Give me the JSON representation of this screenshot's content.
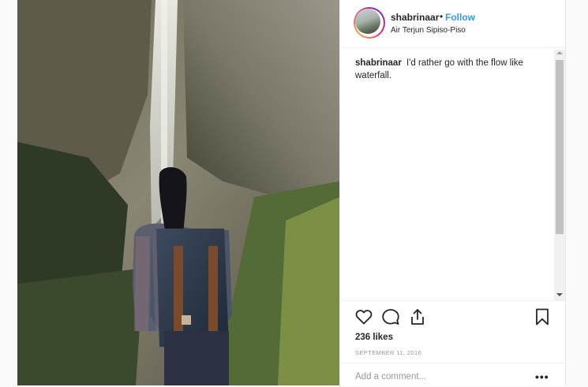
{
  "post": {
    "username": "shabrinaar",
    "separator": "•",
    "follow_label": "Follow",
    "location": "Air Terjun Sipiso-Piso",
    "caption_user": "shabrinaar",
    "caption_text": "I'd rather go with the flow like waterfall.",
    "likes": "236 likes",
    "date": "SEPTEMBER 11, 2016",
    "comment_placeholder": "Add a comment...",
    "more_label": "•••"
  },
  "icons": {
    "like": "heart-icon",
    "comment": "speech-bubble-icon",
    "share": "share-icon",
    "save": "bookmark-icon"
  },
  "colors": {
    "follow": "#3897f0",
    "text": "#262626",
    "muted": "#999999",
    "border": "#efefef"
  }
}
